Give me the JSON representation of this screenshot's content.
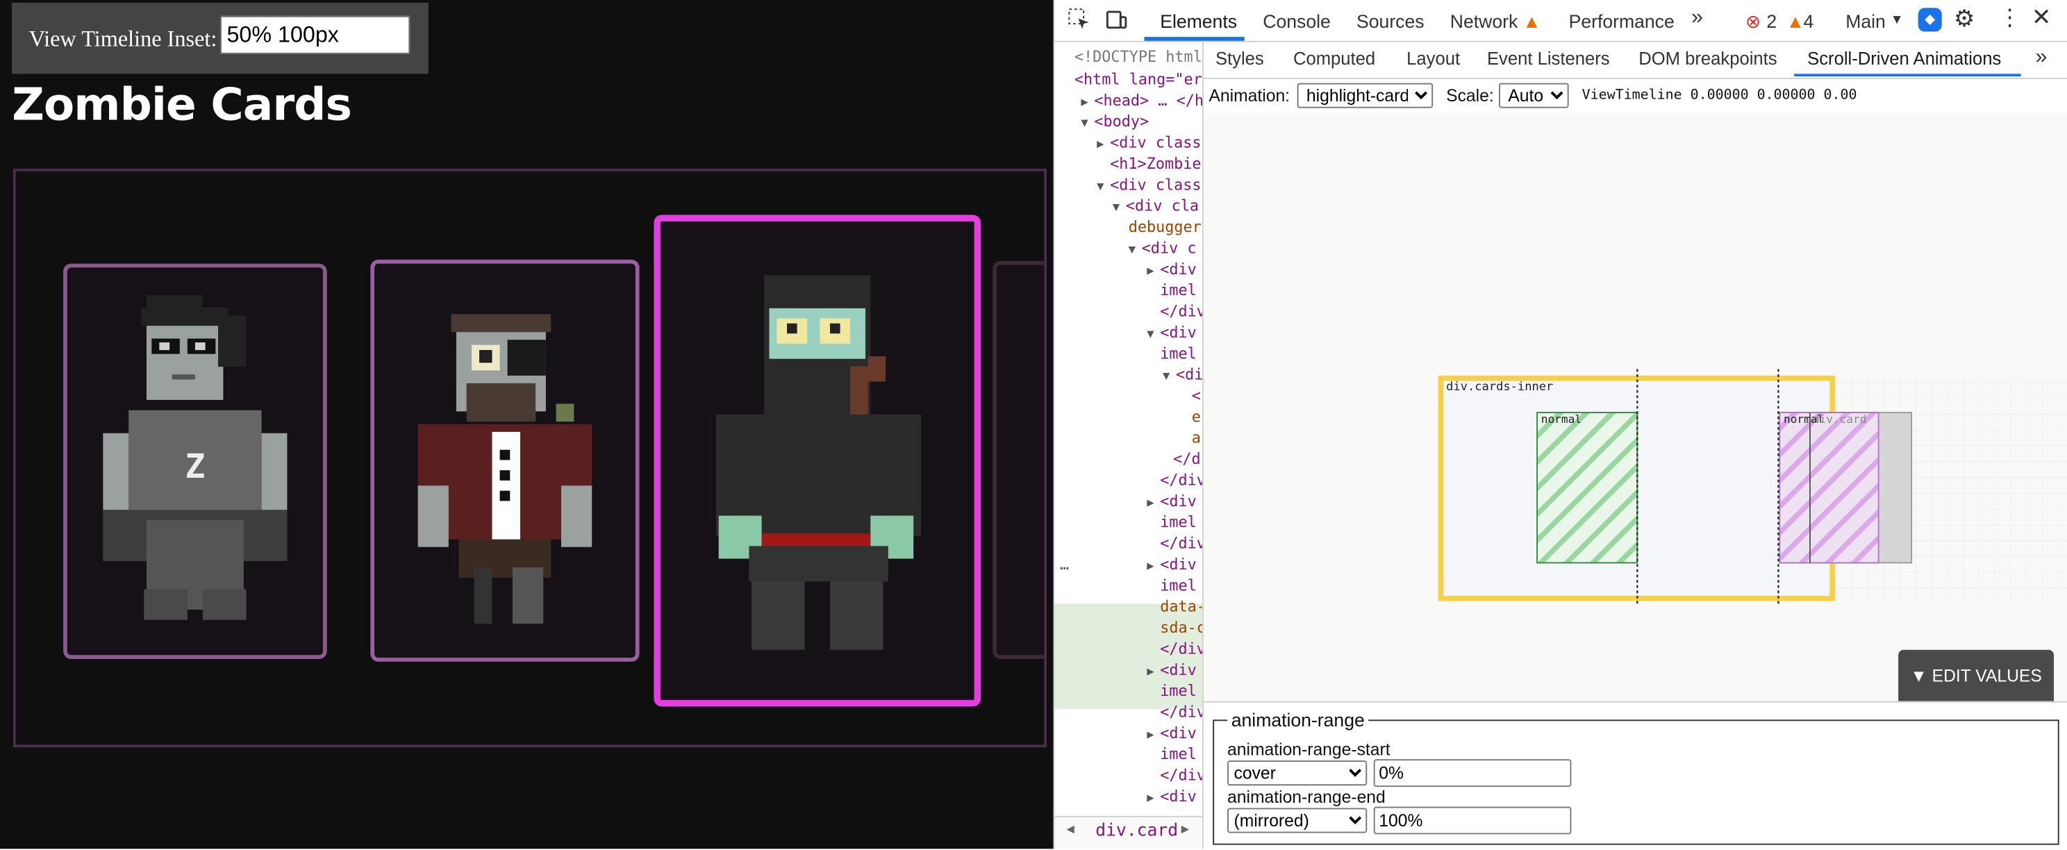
{
  "page": {
    "inset_label": "View Timeline Inset:",
    "inset_value": "50% 100px",
    "title": "Zombie Cards"
  },
  "devtools": {
    "tabs": [
      "Elements",
      "Console",
      "Sources",
      "Network",
      "Performance"
    ],
    "more": "»",
    "errors": "2",
    "warnings": "4",
    "main_label": "Main",
    "subtabs": [
      "Styles",
      "Computed",
      "Layout",
      "Event Listeners",
      "DOM breakpoints",
      "Scroll-Driven Animations"
    ],
    "dom_lines": [
      "<!DOCTYPE html",
      "<html lang=\"er",
      "<head> … </h",
      "<body>",
      "<div class",
      "<h1>Zombie",
      "<div class",
      "<div cla",
      "debugger",
      "<div c",
      "<div",
      "imel",
      "</div",
      "<div",
      "imel",
      "<di",
      "<",
      "e",
      "a",
      "</d",
      "</div",
      "<div",
      "imel",
      "</div",
      "<div",
      "imel",
      "data-",
      "sda-c",
      "</div",
      "<div",
      "imel",
      "</div",
      "<div",
      "imel",
      "</div",
      "<div"
    ],
    "footer_crumb": "div.card",
    "animation_label": "Animation:",
    "animation_value": "highlight-card",
    "scale_label": "Scale:",
    "scale_value": "Auto",
    "timeline_info": "ViewTimeline 0.00000 0.00000 0.00",
    "viz": {
      "scroller_label": "div.cards-inner",
      "subject_label": "div.card",
      "start_label": "normal",
      "end_label": "normal"
    },
    "edit_values": "▼ EDIT VALUES",
    "range": {
      "legend": "animation-range",
      "start_label": "animation-range-start",
      "start_name": "cover",
      "start_offset": "0%",
      "end_label": "animation-range-end",
      "end_name": "(mirrored)",
      "end_offset": "100%"
    }
  },
  "colors": {
    "page_bg": "#0f0f0f",
    "card_border": "#8a5a8e",
    "card_highlight": "#e23ee0",
    "scroller_yellow": "#f6d046",
    "start_green": "#7fd08a",
    "end_purple": "#d8a0e6",
    "accent_blue": "#1a73e8"
  }
}
